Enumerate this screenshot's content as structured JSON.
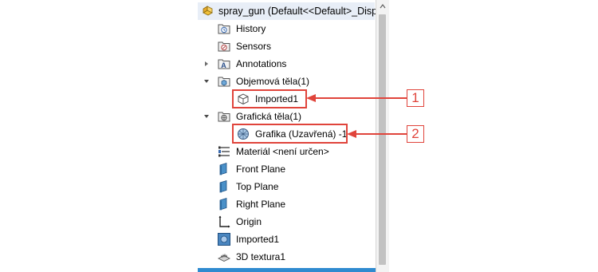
{
  "tree": {
    "root": {
      "label": "spray_gun  (Default<<Default>_Displa",
      "icon": "part-icon"
    },
    "items": [
      {
        "label": "History",
        "icon": "history-folder-icon",
        "arrow": ""
      },
      {
        "label": "Sensors",
        "icon": "sensors-folder-icon",
        "arrow": ""
      },
      {
        "label": "Annotations",
        "icon": "annotations-icon",
        "arrow": "collapsed"
      },
      {
        "label": "Objemová těla(1)",
        "icon": "solid-bodies-folder-icon",
        "arrow": "expanded"
      },
      {
        "label": "Imported1",
        "icon": "solid-body-icon",
        "arrow": ""
      },
      {
        "label": "Grafická těla(1)",
        "icon": "graphics-bodies-folder-icon",
        "arrow": "expanded"
      },
      {
        "label": "Grafika (Uzavřená) -1",
        "icon": "graphics-body-icon",
        "arrow": ""
      },
      {
        "label": "Materiál <není určen>",
        "icon": "material-icon",
        "arrow": ""
      },
      {
        "label": "Front Plane",
        "icon": "plane-icon",
        "arrow": ""
      },
      {
        "label": "Top Plane",
        "icon": "plane-icon",
        "arrow": ""
      },
      {
        "label": "Right Plane",
        "icon": "plane-icon",
        "arrow": ""
      },
      {
        "label": "Origin",
        "icon": "origin-icon",
        "arrow": ""
      },
      {
        "label": "Imported1",
        "icon": "imported-feature-icon",
        "arrow": ""
      },
      {
        "label": "3D textura1",
        "icon": "3d-texture-icon",
        "arrow": ""
      }
    ]
  },
  "callouts": [
    {
      "number": "1"
    },
    {
      "number": "2"
    }
  ],
  "colors": {
    "callout": "#e0443b",
    "selection_bar": "#2f8bd0"
  }
}
